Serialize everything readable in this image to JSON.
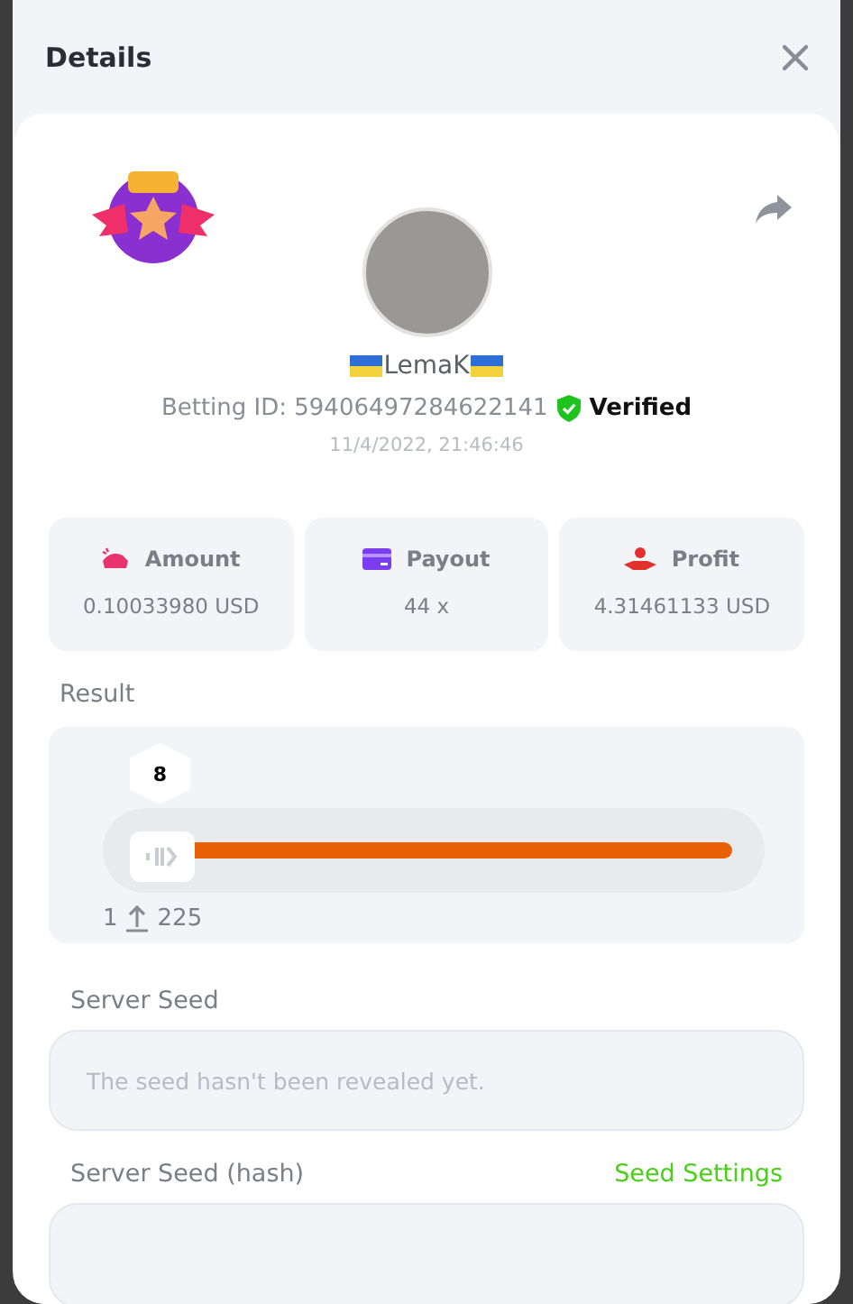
{
  "window": {
    "title": "Details"
  },
  "player": {
    "username": "LemaK",
    "betting_id_label": "Betting ID: 59406497284622141",
    "verified": true,
    "verified_label": "Verified",
    "timestamp": "11/4/2022, 21:46:46"
  },
  "stats": [
    {
      "kind": "amount",
      "label": "Amount",
      "value": "0.10033980 USD"
    },
    {
      "kind": "payout",
      "label": "Payout",
      "value": "44 x"
    },
    {
      "kind": "profit",
      "label": "Profit",
      "value": "4.31461133 USD"
    }
  ],
  "result": {
    "label": "Result",
    "value": "8",
    "level": 0.04,
    "min": "1",
    "max": "225"
  },
  "server_seed": {
    "label": "Server Seed",
    "placeholder": "The seed hasn't been revealed yet."
  },
  "server_seed_hash": {
    "label": "Server Seed (hash)",
    "link": "Seed Settings"
  }
}
